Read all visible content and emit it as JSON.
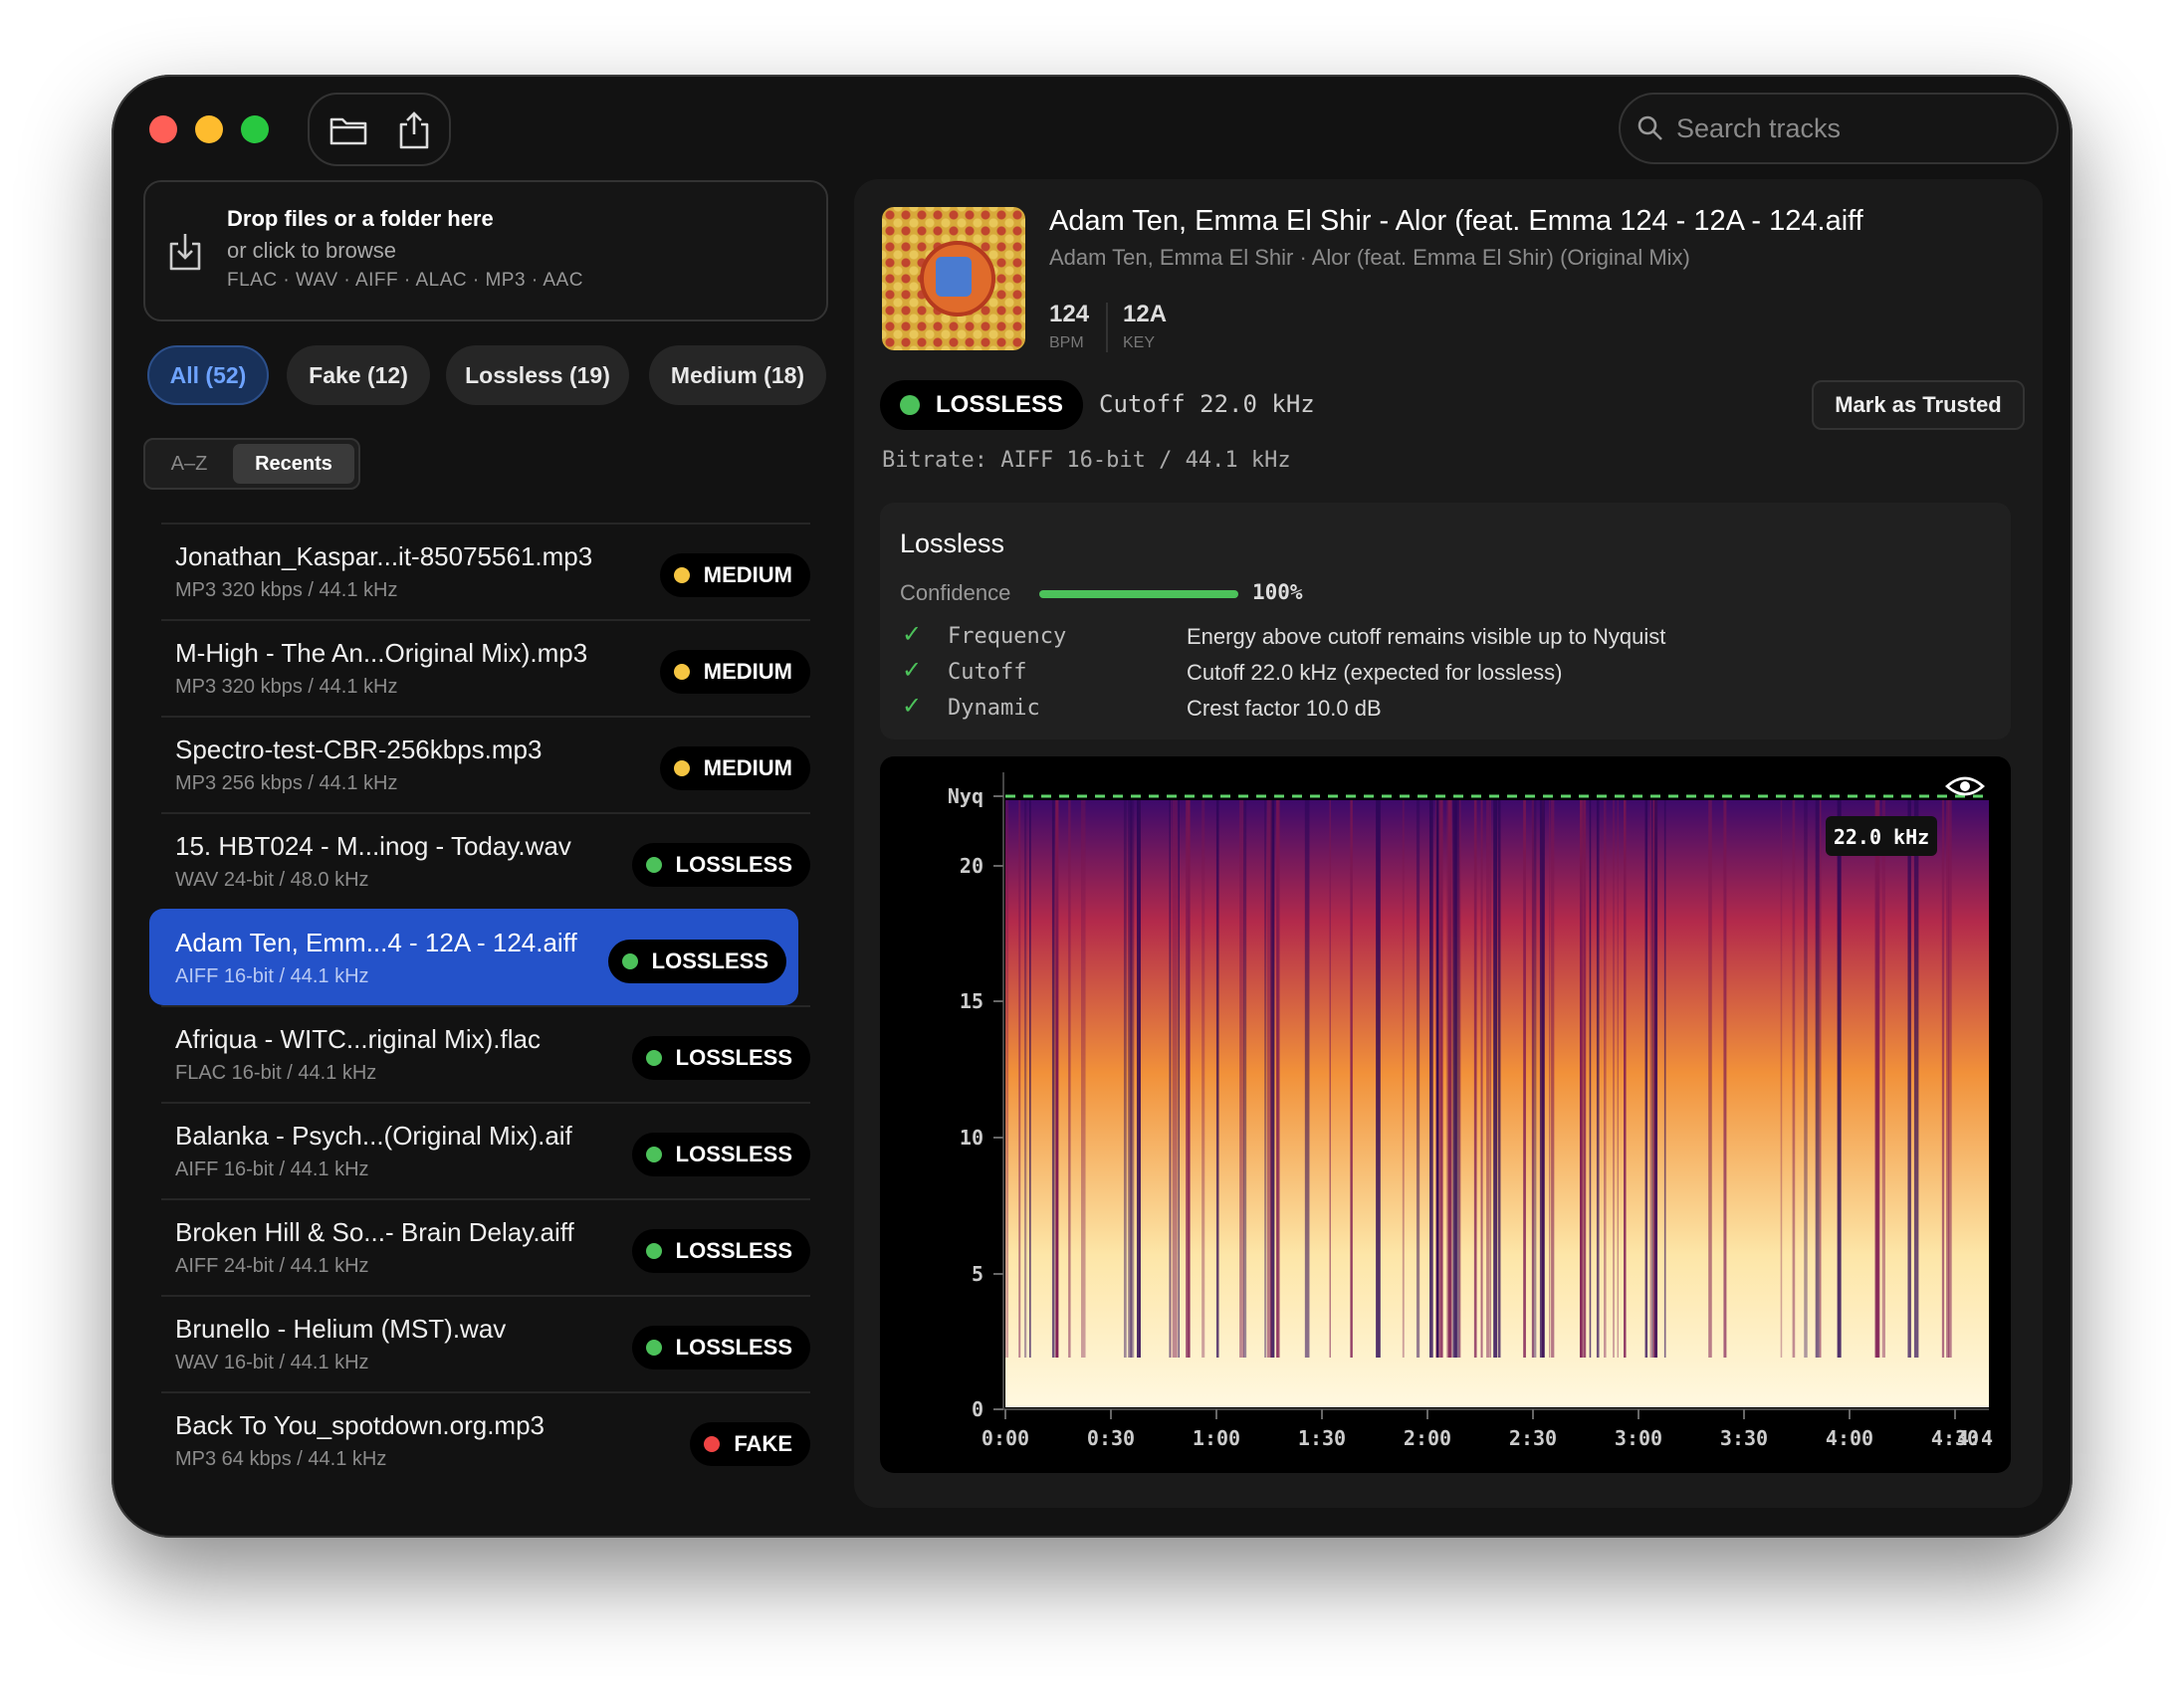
{
  "toolbar": {
    "folder_icon": "folder-icon",
    "share_icon": "share-icon"
  },
  "search": {
    "placeholder": "Search tracks"
  },
  "dropzone": {
    "title": "Drop files or a folder here",
    "subtitle": "or click to browse",
    "formats": "FLAC · WAV · AIFF · ALAC · MP3 · AAC"
  },
  "filters": [
    {
      "label": "All (52)",
      "active": true
    },
    {
      "label": "Fake (12)"
    },
    {
      "label": "Lossless (19)"
    },
    {
      "label": "Medium (18)"
    }
  ],
  "sort": {
    "az": "A–Z",
    "recents": "Recents",
    "selected": "Recents"
  },
  "colors": {
    "medium": "#f5c542",
    "lossless": "#4cc15a",
    "fake": "#ef4444",
    "accent": "#2452c9"
  },
  "tracks": [
    {
      "name": "Jonathan_Kaspar...it-85075561.mp3",
      "sub": "MP3 320 kbps / 44.1 kHz",
      "badge": "MEDIUM"
    },
    {
      "name": "M-High - The An...Original Mix).mp3",
      "sub": "MP3 320 kbps / 44.1 kHz",
      "badge": "MEDIUM"
    },
    {
      "name": "Spectro-test-CBR-256kbps.mp3",
      "sub": "MP3 256 kbps / 44.1 kHz",
      "badge": "MEDIUM"
    },
    {
      "name": "15. HBT024 - M...inog - Today.wav",
      "sub": "WAV 24-bit / 48.0 kHz",
      "badge": "LOSSLESS"
    },
    {
      "name": "Adam Ten, Emm...4 - 12A - 124.aiff",
      "sub": "AIFF 16-bit / 44.1 kHz",
      "badge": "LOSSLESS",
      "selected": true
    },
    {
      "name": "Afriqua - WITC...riginal Mix).flac",
      "sub": "FLAC 16-bit / 44.1 kHz",
      "badge": "LOSSLESS"
    },
    {
      "name": "Balanka - Psych...(Original Mix).aif",
      "sub": "AIFF 16-bit / 44.1 kHz",
      "badge": "LOSSLESS"
    },
    {
      "name": "Broken Hill & So...- Brain Delay.aiff",
      "sub": "AIFF 24-bit / 44.1 kHz",
      "badge": "LOSSLESS"
    },
    {
      "name": "Brunello - Helium (MST).wav",
      "sub": "WAV 16-bit / 44.1 kHz",
      "badge": "LOSSLESS"
    },
    {
      "name": "Back To You_spotdown.org.mp3",
      "sub": "MP3 64 kbps / 44.1 kHz",
      "badge": "FAKE"
    }
  ],
  "detail": {
    "title": "Adam Ten, Emma El Shir - Alor (feat. Emma 124 - 12A - 124.aiff",
    "subtitle": "Adam Ten, Emma El Shir · Alor (feat. Emma El Shir) (Original Mix)",
    "bpm_value": "124",
    "bpm_label": "BPM",
    "key_value": "12A",
    "key_label": "KEY",
    "status": "LOSSLESS",
    "cutoff": "Cutoff 22.0 kHz",
    "mark_trusted": "Mark as Trusted",
    "bitrate": "Bitrate: AIFF 16-bit / 44.1 kHz",
    "verdict": "Lossless",
    "confidence_label": "Confidence",
    "confidence_value": "100%",
    "confidence_fraction": 1.0,
    "checks": [
      {
        "name": "Frequency",
        "text": "Energy above cutoff remains visible up to Nyquist"
      },
      {
        "name": "Cutoff",
        "text": "Cutoff 22.0 kHz (expected for lossless)"
      },
      {
        "name": "Dynamic",
        "text": "Crest factor 10.0 dB"
      }
    ]
  },
  "spectrogram": {
    "y_ticks": [
      "0",
      "5",
      "10",
      "15",
      "20",
      "Nyq"
    ],
    "x_ticks": [
      "0:00",
      "0:30",
      "1:00",
      "1:30",
      "2:00",
      "2:30",
      "3:00",
      "3:30",
      "4:00",
      "4:30"
    ],
    "x_end_tick": "4:4",
    "cutoff_label": "22.0 kHz",
    "eye_icon": "eye-icon"
  }
}
